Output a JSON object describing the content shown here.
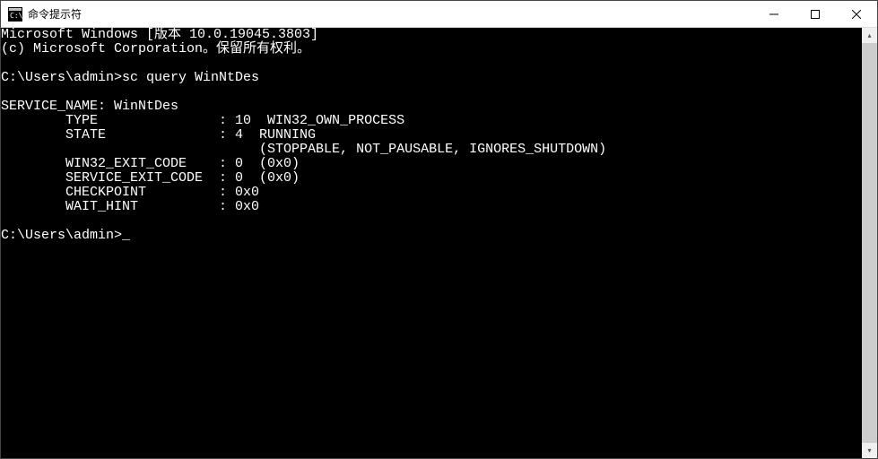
{
  "titlebar": {
    "title": "命令提示符",
    "minimize": "—",
    "maximize": "□",
    "close": "✕"
  },
  "console": {
    "line01": "Microsoft Windows [版本 10.0.19045.3803]",
    "line02": "(c) Microsoft Corporation。保留所有权利。",
    "line03": "",
    "line04_prompt": "C:\\Users\\admin>",
    "line04_cmd": "sc query WinNtDes",
    "line05": "",
    "line06": "SERVICE_NAME: WinNtDes",
    "line07": "        TYPE               : 10  WIN32_OWN_PROCESS",
    "line08": "        STATE              : 4  RUNNING",
    "line09": "                                (STOPPABLE, NOT_PAUSABLE, IGNORES_SHUTDOWN)",
    "line10": "        WIN32_EXIT_CODE    : 0  (0x0)",
    "line11": "        SERVICE_EXIT_CODE  : 0  (0x0)",
    "line12": "        CHECKPOINT         : 0x0",
    "line13": "        WAIT_HINT          : 0x0",
    "line14": "",
    "line15_prompt": "C:\\Users\\admin>",
    "cursor": "_"
  },
  "scroll": {
    "up": "▴",
    "down": "▾"
  }
}
